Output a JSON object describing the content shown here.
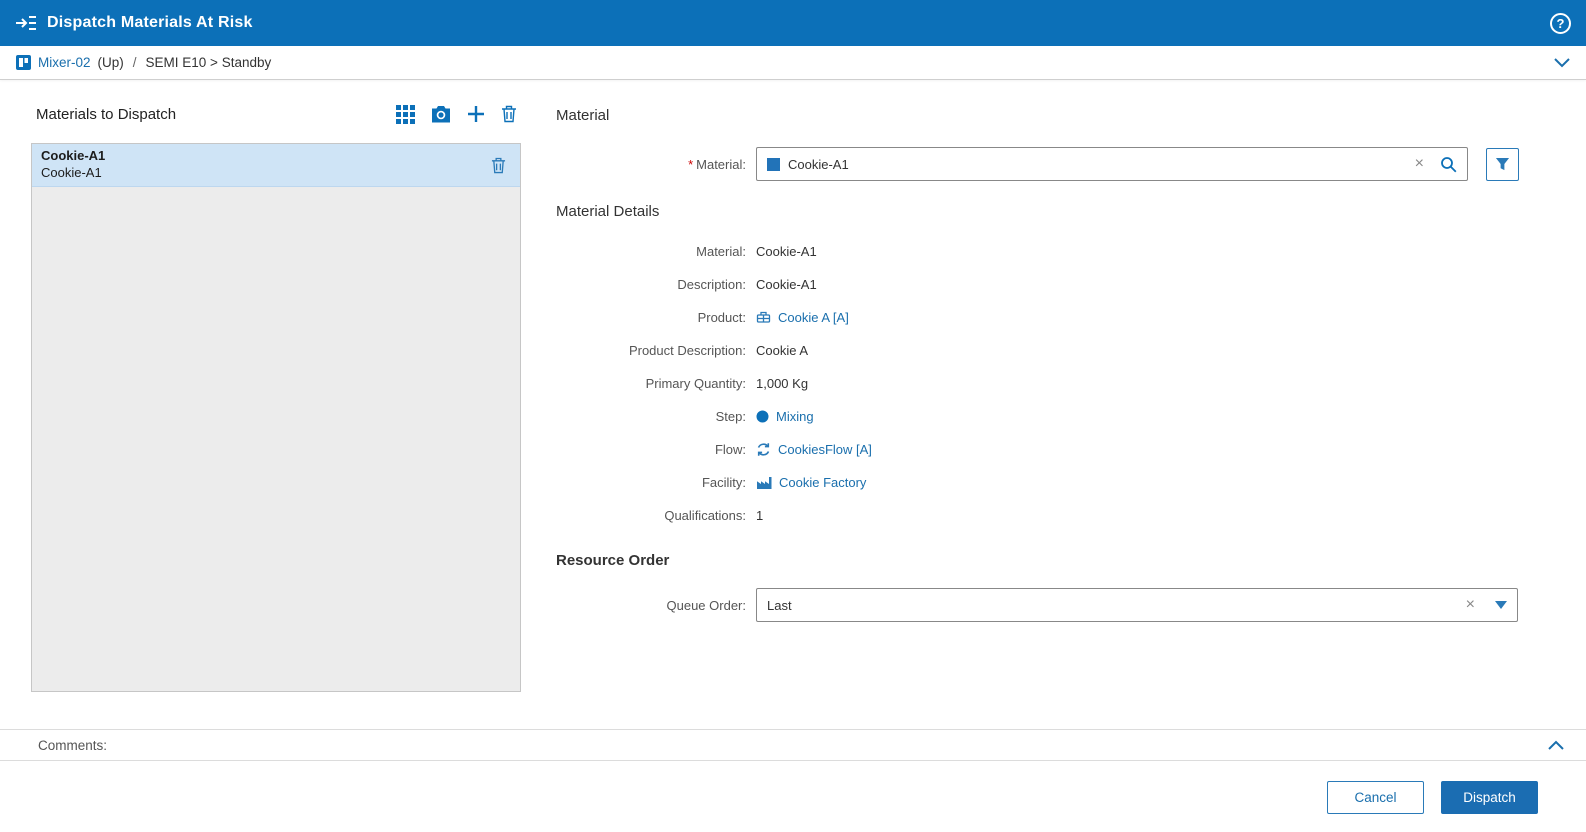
{
  "header": {
    "title": "Dispatch Materials At Risk",
    "help_glyph": "?"
  },
  "breadcrumb": {
    "resource": "Mixer-02",
    "state": "(Up)",
    "separator": "/",
    "status": "SEMI E10 > Standby"
  },
  "left_panel": {
    "title": "Materials to Dispatch",
    "items": [
      {
        "title": "Cookie-A1",
        "subtitle": "Cookie-A1"
      }
    ]
  },
  "material_section": {
    "title": "Material",
    "required_marker": "*",
    "label": "Material:",
    "value": "Cookie-A1",
    "clear_glyph": "×"
  },
  "material_details": {
    "title": "Material Details",
    "rows": [
      {
        "label": "Material:",
        "value": "Cookie-A1"
      },
      {
        "label": "Description:",
        "value": "Cookie-A1"
      },
      {
        "label": "Product:",
        "value": "Cookie A [A]"
      },
      {
        "label": "Product Description:",
        "value": "Cookie A"
      },
      {
        "label": "Primary Quantity:",
        "value": "1,000 Kg"
      },
      {
        "label": "Step:",
        "value": "Mixing"
      },
      {
        "label": "Flow:",
        "value": "CookiesFlow [A]"
      },
      {
        "label": "Facility:",
        "value": "Cookie Factory"
      },
      {
        "label": "Qualifications:",
        "value": "1"
      }
    ]
  },
  "resource_order": {
    "title": "Resource Order",
    "label": "Queue Order:",
    "value": "Last",
    "clear_glyph": "×"
  },
  "comments": {
    "label": "Comments:"
  },
  "footer": {
    "cancel_label": "Cancel",
    "dispatch_label": "Dispatch"
  },
  "colors": {
    "header_blue": "#0c70b8",
    "link_blue": "#1a6fad",
    "selected_row": "#cfe4f6",
    "primary_button": "#1b6db2",
    "required_red": "#cc0000"
  }
}
